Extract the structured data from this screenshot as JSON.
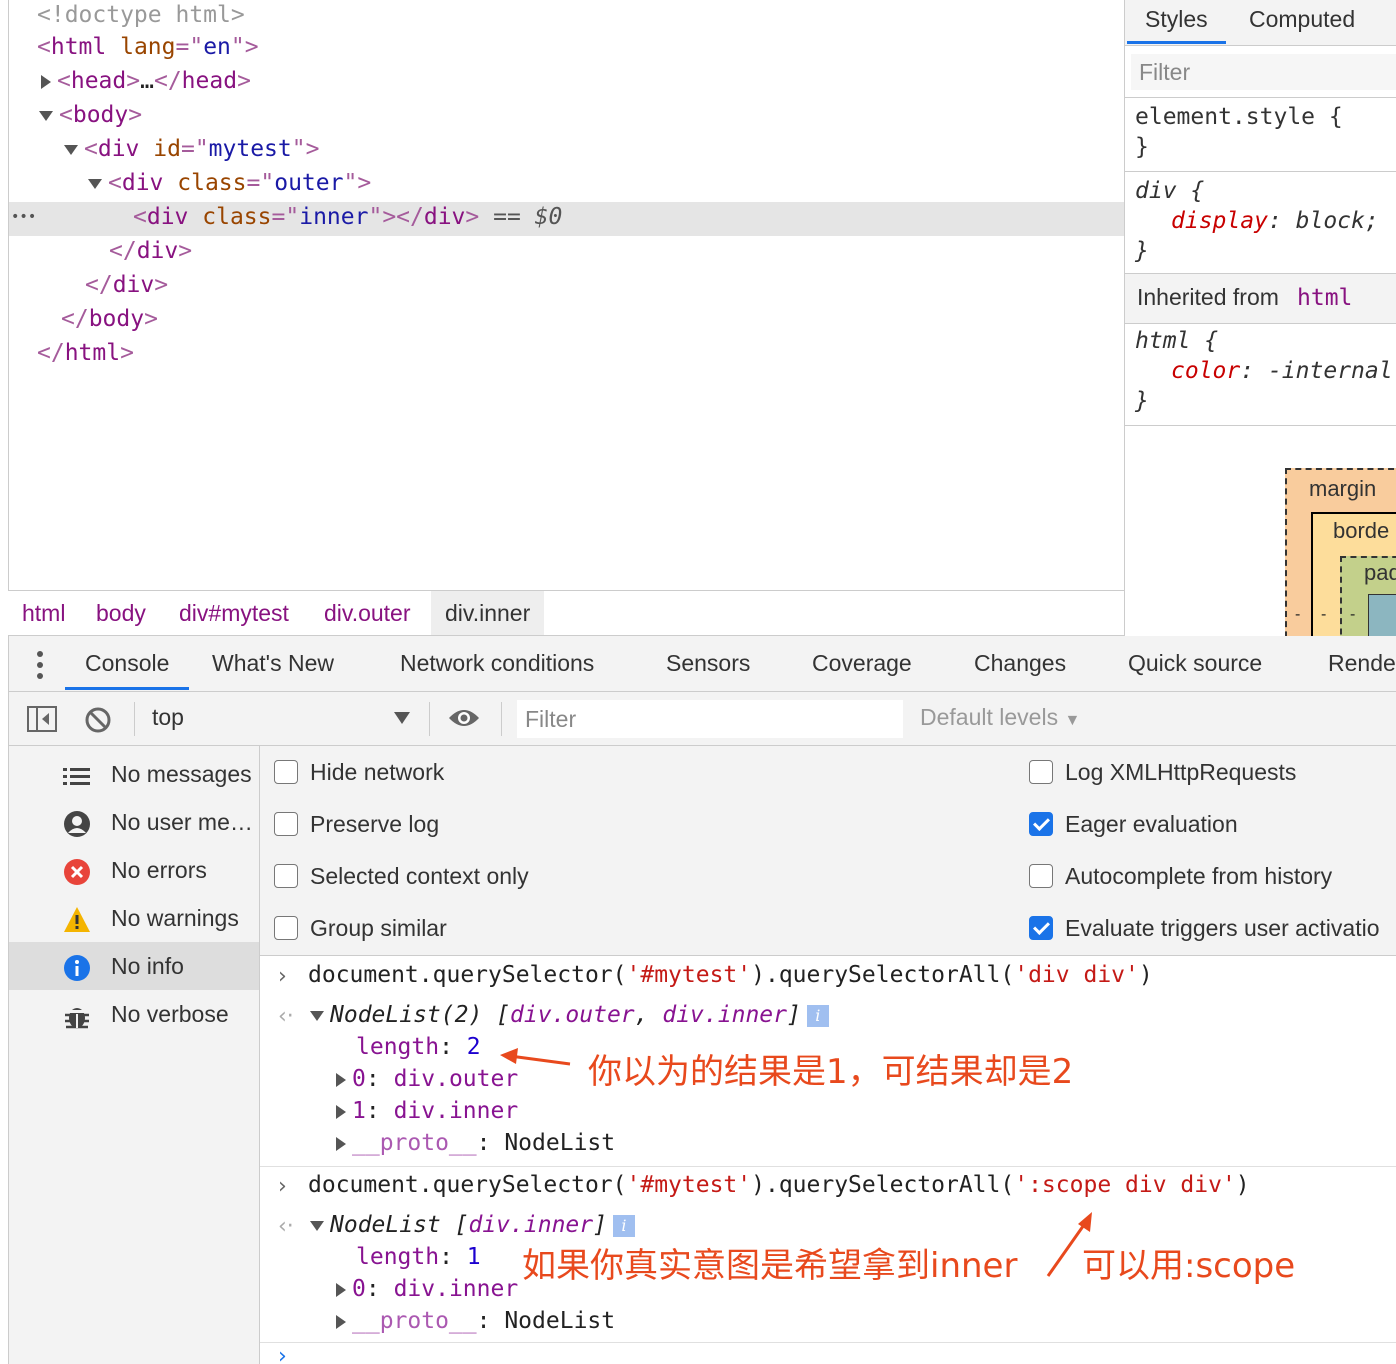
{
  "elements": {
    "doctype": "<!doctype html>",
    "html_open_tag": "html",
    "lang_attr": "lang",
    "lang_val": "en",
    "head_tag": "head",
    "head_ellipsis": "…",
    "body_tag": "body",
    "div_tag": "div",
    "id_attr": "id",
    "id_val": "mytest",
    "class_attr": "class",
    "outer_val": "outer",
    "inner_val": "inner",
    "selected_marker": "== $0",
    "row_dots": "•••"
  },
  "breadcrumbs": [
    "html",
    "body",
    "div#mytest",
    "div.outer",
    "div.inner"
  ],
  "styles": {
    "tabs": [
      "Styles",
      "Computed"
    ],
    "filter_placeholder": "Filter",
    "element_style": "element.style {",
    "close_brace": "}",
    "div_selector": "div",
    "open_brace": "{",
    "display_prop": "display",
    "display_val": "block;",
    "inherited_label": "Inherited from",
    "inherited_tag": "html",
    "html_selector": "html",
    "color_prop": "color",
    "color_val": "-internal",
    "box_margin": "margin",
    "box_border": "borde",
    "box_padding": "pad",
    "box_dash": "-"
  },
  "drawer": {
    "tabs": [
      "Console",
      "What's New",
      "Network conditions",
      "Sensors",
      "Coverage",
      "Changes",
      "Quick source",
      "Rende"
    ]
  },
  "toolbar": {
    "context": "top",
    "filter_placeholder": "Filter",
    "levels": "Default levels"
  },
  "sidebar": {
    "items": [
      {
        "label": "No messages",
        "icon": "list-icon"
      },
      {
        "label": "No user me…",
        "icon": "user-icon"
      },
      {
        "label": "No errors",
        "icon": "error-icon"
      },
      {
        "label": "No warnings",
        "icon": "warning-icon"
      },
      {
        "label": "No info",
        "icon": "info-icon"
      },
      {
        "label": "No verbose",
        "icon": "bug-icon"
      }
    ]
  },
  "settings": {
    "left": [
      {
        "label": "Hide network",
        "checked": false
      },
      {
        "label": "Preserve log",
        "checked": false
      },
      {
        "label": "Selected context only",
        "checked": false
      },
      {
        "label": "Group similar",
        "checked": false
      }
    ],
    "right": [
      {
        "label": "Log XMLHttpRequests",
        "checked": false
      },
      {
        "label": "Eager evaluation",
        "checked": true
      },
      {
        "label": "Autocomplete from history",
        "checked": false
      },
      {
        "label": "Evaluate triggers user activatio",
        "checked": true
      }
    ]
  },
  "console": {
    "cmd1_prefix": "document.querySelector(",
    "cmd1_arg1": "'#mytest'",
    "cmd1_mid": ").querySelectorAll(",
    "cmd1_arg2": "'div div'",
    "cmd1_end": ")",
    "res1_head": "NodeList(2)",
    "res1_open": " [",
    "res1_item1": "div.outer",
    "res1_comma": ", ",
    "res1_item2": "div.inner",
    "res1_close": "]",
    "length_key": "length",
    "res1_length": "2",
    "res1_idx0": "0",
    "res1_val0": "div.outer",
    "res1_idx1": "1",
    "res1_val1": "div.inner",
    "proto_key": "__proto__",
    "proto_val": "NodeList",
    "cmd2_arg2": "':scope div div'",
    "res2_head": "NodeList",
    "res2_item": "div.inner",
    "res2_length": "1",
    "res2_idx0": "0",
    "res2_val0": "div.inner",
    "info_badge": "i"
  },
  "annotations": {
    "note1": "你以为的结果是1，可结果却是2",
    "note2_a": "如果你真实意图是希望拿到inner",
    "note2_b": "可以用:scope"
  },
  "colors": {
    "annotation": "#e8491d",
    "accent": "#1a73e8",
    "tag": "#881280"
  }
}
